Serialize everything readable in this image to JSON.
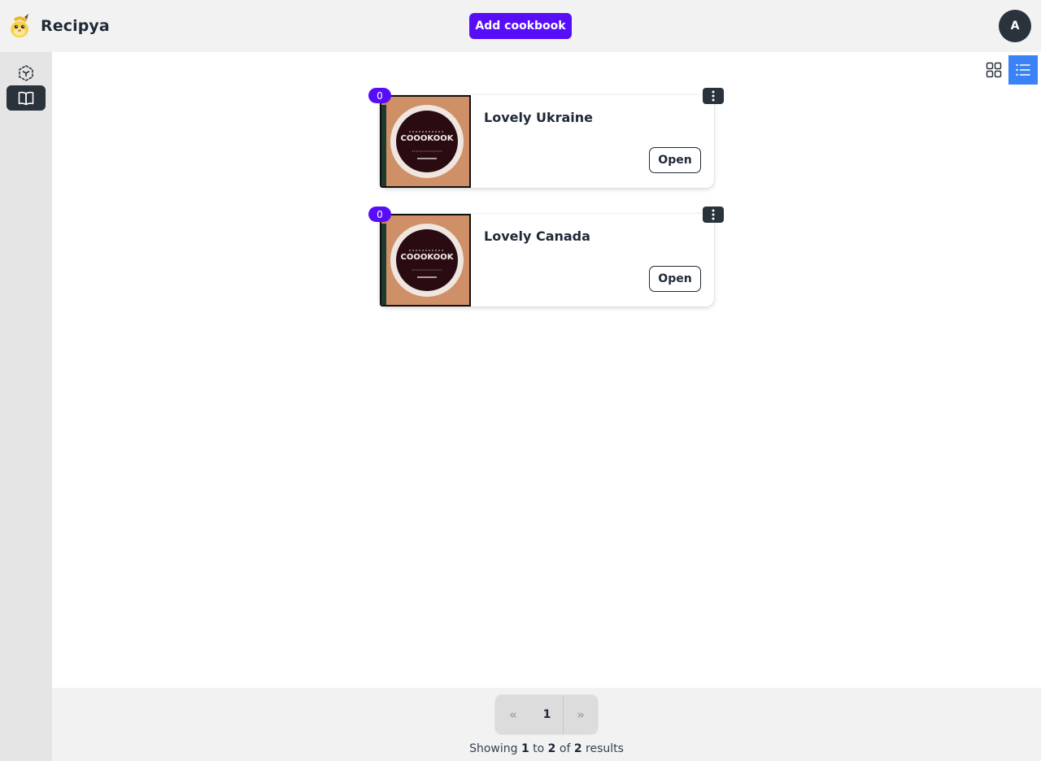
{
  "app": {
    "name": "Recipya",
    "avatar_initial": "A"
  },
  "header": {
    "add_button_label": "Add cookbook"
  },
  "sidebar": {
    "items": [
      {
        "icon": "cube-dashed-icon",
        "active": false
      },
      {
        "icon": "book-icon",
        "active": true
      }
    ]
  },
  "view_modes": [
    {
      "icon": "grid-icon",
      "active": false
    },
    {
      "icon": "list-icon",
      "active": true
    }
  ],
  "cookbooks": [
    {
      "title": "Lovely Ukraine",
      "recipe_count": "0",
      "open_label": "Open",
      "image_text": "COOOKOOK"
    },
    {
      "title": "Lovely Canada",
      "recipe_count": "0",
      "open_label": "Open",
      "image_text": "COOOKOOK"
    }
  ],
  "pagination": {
    "prev": "«",
    "current": "1",
    "next": "»"
  },
  "results": {
    "prefix": "Showing",
    "from": "1",
    "to_word": "to",
    "to": "2",
    "of_word": "of",
    "total": "2",
    "suffix": "results"
  },
  "colors": {
    "primary": "#570df8",
    "dark": "#2a323c",
    "accent_blue": "#3b82f6"
  }
}
